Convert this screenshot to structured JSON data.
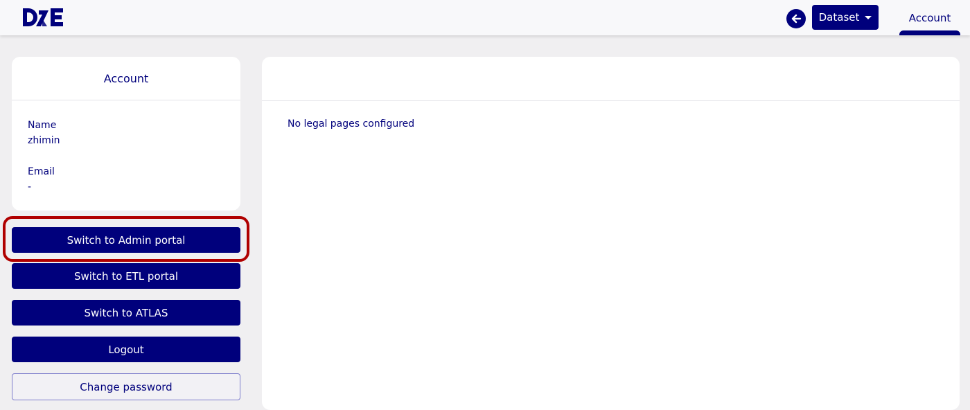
{
  "topbar": {
    "logo_text": "D2E",
    "back_icon": "arrow-left-icon",
    "dataset_label": "Dataset",
    "account_tab_label": "Account"
  },
  "account_card": {
    "title": "Account",
    "name_label": "Name",
    "name_value": "zhimin",
    "email_label": "Email",
    "email_value": "-"
  },
  "actions": {
    "admin_portal": "Switch to Admin portal",
    "etl_portal": "Switch to ETL portal",
    "atlas": "Switch to ATLAS",
    "logout": "Logout",
    "change_password": "Change password"
  },
  "main": {
    "message": "No legal pages configured"
  },
  "colors": {
    "primary": "#00007c",
    "background": "#f0eff1",
    "highlight": "#b00000"
  }
}
